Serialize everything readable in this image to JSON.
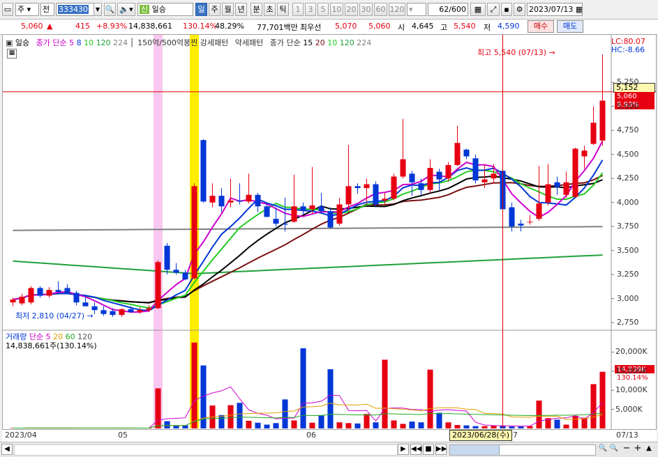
{
  "toolbar": {
    "type_label": "주",
    "period_label": "전",
    "code": "333430",
    "name": "일승",
    "name_prefix": "신",
    "periods": [
      "일",
      "주",
      "월",
      "년",
      "분",
      "초",
      "틱"
    ],
    "minutes": [
      "1",
      "3",
      "5",
      "10",
      "20",
      "30",
      "60",
      "120"
    ],
    "count": "62",
    "total": "/600",
    "date": "2023/07/13"
  },
  "quote": {
    "price": "5,060",
    "change_arrow": "▲",
    "change": "415",
    "change_pct": "+8.93%",
    "volume": "14,838,661",
    "volume_ratio": "130.14%",
    "turnover": "48.29%",
    "amount": "77,701백만",
    "best_ask_label": "최우선",
    "best_ask": "5,070",
    "best_bid": "5,060",
    "open_label": "시",
    "open": "4,645",
    "high_label": "고",
    "high": "5,540",
    "low_label": "저",
    "low": "4,590",
    "buy_label": "매수",
    "sell_label": "매도"
  },
  "legend": {
    "name": "일승",
    "ma_label": "종가 단순",
    "ma_periods": [
      "5",
      "8",
      "10",
      "120",
      "224"
    ],
    "box_label": "150억/500억봉찐",
    "strong_pattern": "강세패턴",
    "weak_pattern": "약세패턴",
    "ma2_label": "종가 단순",
    "ma2_periods": [
      "15",
      "20",
      "10",
      "120",
      "224"
    ],
    "lc": "LC:80.07",
    "hc": "HC:-8.66"
  },
  "annotations": {
    "high_note": "최고 5,540 (07/13) →",
    "low_note": "최저 2,810 (04/27) →",
    "crosshair_price": "5,152",
    "current_price": "5,060",
    "current_pct": "8.93%",
    "vol_value": "14,839K",
    "vol_pct": "130.14%",
    "crosshair_date": "2023/06/28(수)"
  },
  "volume_legend": {
    "label": "거래량",
    "ma_label": "단순",
    "periods": [
      "5",
      "20",
      "60",
      "120"
    ],
    "summary": "14,838,661주(130.14%)"
  },
  "price_axis": [
    "5,250",
    "5,000",
    "4,750",
    "4,500",
    "4,250",
    "4,000",
    "3,750",
    "3,500",
    "3,250",
    "3,000",
    "2,750"
  ],
  "volume_axis": [
    "20,000K",
    "15,000K",
    "10,000K",
    "5,000K"
  ],
  "x_axis": [
    "2023/04",
    "05",
    "06",
    "07",
    "07/13"
  ],
  "colors": {
    "up": "#e60012",
    "down": "#0037d6",
    "ma5": "#cc00cc",
    "ma10": "#22cc22",
    "ma20": "#000000",
    "ma60": "#7a1010",
    "ma120": "#1fa03a",
    "ma224": "#808080"
  },
  "chart_data": {
    "type": "candlestick",
    "ylim": [
      2700,
      5600
    ],
    "candles": [
      {
        "o": 2960,
        "h": 3010,
        "l": 2920,
        "c": 2990
      },
      {
        "o": 2950,
        "h": 3050,
        "l": 2930,
        "c": 3020
      },
      {
        "o": 2960,
        "h": 3130,
        "l": 2940,
        "c": 3110
      },
      {
        "o": 3110,
        "h": 3130,
        "l": 3010,
        "c": 3030
      },
      {
        "o": 3030,
        "h": 3120,
        "l": 3010,
        "c": 3090
      },
      {
        "o": 3090,
        "h": 3180,
        "l": 3050,
        "c": 3070
      },
      {
        "o": 3110,
        "h": 3150,
        "l": 3050,
        "c": 3060
      },
      {
        "o": 3060,
        "h": 3080,
        "l": 2930,
        "c": 2960
      },
      {
        "o": 2960,
        "h": 3030,
        "l": 2920,
        "c": 2920
      },
      {
        "o": 2920,
        "h": 2960,
        "l": 2840,
        "c": 2880
      },
      {
        "o": 2880,
        "h": 2920,
        "l": 2820,
        "c": 2840
      },
      {
        "o": 2870,
        "h": 2900,
        "l": 2810,
        "c": 2830
      },
      {
        "o": 2830,
        "h": 2900,
        "l": 2810,
        "c": 2890
      },
      {
        "o": 2890,
        "h": 2920,
        "l": 2850,
        "c": 2860
      },
      {
        "o": 2860,
        "h": 2910,
        "l": 2840,
        "c": 2880
      },
      {
        "o": 2880,
        "h": 2930,
        "l": 2860,
        "c": 2900
      },
      {
        "o": 2900,
        "h": 3400,
        "l": 2890,
        "c": 3380
      },
      {
        "o": 3550,
        "h": 3580,
        "l": 3250,
        "c": 3300
      },
      {
        "o": 3300,
        "h": 3370,
        "l": 3250,
        "c": 3270
      },
      {
        "o": 3270,
        "h": 3300,
        "l": 3190,
        "c": 3200
      },
      {
        "o": 3210,
        "h": 4200,
        "l": 3200,
        "c": 4170
      },
      {
        "o": 4650,
        "h": 4660,
        "l": 4000,
        "c": 4010
      },
      {
        "o": 4000,
        "h": 4200,
        "l": 3950,
        "c": 4070
      },
      {
        "o": 4070,
        "h": 4150,
        "l": 3900,
        "c": 3960
      },
      {
        "o": 4000,
        "h": 4250,
        "l": 3950,
        "c": 4020
      },
      {
        "o": 4020,
        "h": 4200,
        "l": 3980,
        "c": 4010
      },
      {
        "o": 4010,
        "h": 4300,
        "l": 3990,
        "c": 4080
      },
      {
        "o": 4080,
        "h": 4100,
        "l": 3900,
        "c": 3960
      },
      {
        "o": 3960,
        "h": 4000,
        "l": 3850,
        "c": 3850
      },
      {
        "o": 3830,
        "h": 3950,
        "l": 3750,
        "c": 3780
      },
      {
        "o": 3780,
        "h": 4050,
        "l": 3700,
        "c": 3770
      },
      {
        "o": 3800,
        "h": 4290,
        "l": 3790,
        "c": 3960
      },
      {
        "o": 3960,
        "h": 4000,
        "l": 3880,
        "c": 3920
      },
      {
        "o": 3930,
        "h": 4370,
        "l": 3880,
        "c": 3970
      },
      {
        "o": 3960,
        "h": 4100,
        "l": 3900,
        "c": 3910
      },
      {
        "o": 3910,
        "h": 3950,
        "l": 3730,
        "c": 3740
      },
      {
        "o": 3780,
        "h": 4050,
        "l": 3760,
        "c": 3980
      },
      {
        "o": 3980,
        "h": 4600,
        "l": 3910,
        "c": 4170
      },
      {
        "o": 4170,
        "h": 4200,
        "l": 4090,
        "c": 4150
      },
      {
        "o": 4150,
        "h": 4250,
        "l": 4000,
        "c": 4190
      },
      {
        "o": 4190,
        "h": 4220,
        "l": 3950,
        "c": 3980
      },
      {
        "o": 4020,
        "h": 4100,
        "l": 3980,
        "c": 4040
      },
      {
        "o": 4040,
        "h": 4300,
        "l": 4020,
        "c": 4270
      },
      {
        "o": 4270,
        "h": 4870,
        "l": 4250,
        "c": 4450
      },
      {
        "o": 4300,
        "h": 4330,
        "l": 4070,
        "c": 4210
      },
      {
        "o": 4200,
        "h": 4250,
        "l": 4080,
        "c": 4130
      },
      {
        "o": 4130,
        "h": 4450,
        "l": 4100,
        "c": 4360
      },
      {
        "o": 4320,
        "h": 4350,
        "l": 4130,
        "c": 4240
      },
      {
        "o": 4250,
        "h": 4420,
        "l": 4220,
        "c": 4390
      },
      {
        "o": 4390,
        "h": 4800,
        "l": 4380,
        "c": 4620
      },
      {
        "o": 4550,
        "h": 4560,
        "l": 4450,
        "c": 4480
      },
      {
        "o": 4460,
        "h": 4500,
        "l": 4200,
        "c": 4230
      },
      {
        "o": 4210,
        "h": 4400,
        "l": 4150,
        "c": 4240
      },
      {
        "o": 4250,
        "h": 4400,
        "l": 4200,
        "c": 4300
      },
      {
        "o": 4330,
        "h": 4350,
        "l": 3920,
        "c": 3930
      },
      {
        "o": 3950,
        "h": 4000,
        "l": 3700,
        "c": 3750
      },
      {
        "o": 3780,
        "h": 3820,
        "l": 3700,
        "c": 3760
      },
      {
        "o": 3800,
        "h": 3870,
        "l": 3770,
        "c": 3800
      },
      {
        "o": 3830,
        "h": 4380,
        "l": 3810,
        "c": 3990
      },
      {
        "o": 4000,
        "h": 4400,
        "l": 3970,
        "c": 4190
      },
      {
        "o": 4210,
        "h": 4270,
        "l": 4080,
        "c": 4160
      },
      {
        "o": 4080,
        "h": 4320,
        "l": 4050,
        "c": 4210
      },
      {
        "o": 4060,
        "h": 4570,
        "l": 4050,
        "c": 4560
      },
      {
        "o": 4480,
        "h": 4590,
        "l": 4350,
        "c": 4540
      },
      {
        "o": 4610,
        "h": 5000,
        "l": 4600,
        "c": 4830
      },
      {
        "o": 4645,
        "h": 5540,
        "l": 4590,
        "c": 5060
      }
    ],
    "volumes": [
      100,
      100,
      150,
      120,
      100,
      110,
      90,
      80,
      90,
      100,
      110,
      90,
      80,
      90,
      90,
      100,
      10500,
      1900,
      700,
      800,
      22500,
      16500,
      6000,
      3500,
      6100,
      6700,
      2000,
      1500,
      1000,
      1400,
      7600,
      2100,
      21000,
      1500,
      3500,
      15500,
      1600,
      1400,
      1300,
      3800,
      1600,
      18000,
      2100,
      1200,
      1800,
      1600,
      15400,
      4100,
      1600,
      900,
      800,
      600,
      600,
      800,
      700,
      500,
      500,
      600,
      7300,
      2700,
      2300,
      1000,
      3300,
      2800,
      11600,
      14839
    ]
  }
}
